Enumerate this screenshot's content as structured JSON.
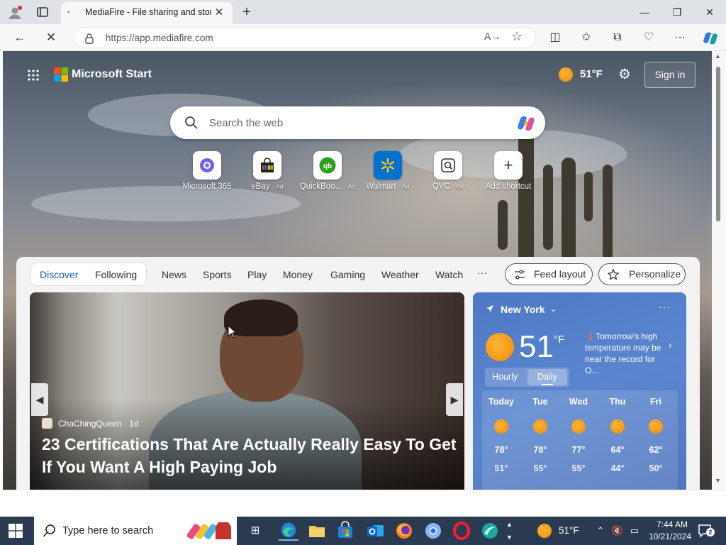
{
  "browser": {
    "tab_title": "MediaFire - File sharing and storage",
    "tab_close": "✕",
    "new_tab": "+",
    "url": "https://app.mediafire.com",
    "read_aloud": "A→",
    "window_buttons": {
      "minimize": "—",
      "restore": "❐",
      "close": "✕"
    }
  },
  "header": {
    "brand": "Microsoft Start",
    "temp": "51°F",
    "sign_in": "Sign in"
  },
  "search": {
    "placeholder": "Search the web"
  },
  "shortcuts": [
    {
      "name": "Microsoft 365",
      "ad": ""
    },
    {
      "name": "eBay",
      "ad": "· Ad"
    },
    {
      "name": "QuickBoo...",
      "ad": "· Ad"
    },
    {
      "name": "Walmart",
      "ad": "· Ad"
    },
    {
      "name": "QVC",
      "ad": "· Ad"
    },
    {
      "name": "Add shortcut",
      "ad": ""
    }
  ],
  "feed_nav": {
    "discover": "Discover",
    "following": "Following",
    "tabs": [
      "News",
      "Sports",
      "Play",
      "Money",
      "Gaming",
      "Weather",
      "Watch"
    ],
    "more": "···",
    "feed_layout": "Feed layout",
    "personalize": "Personalize"
  },
  "story": {
    "source": "ChaChingQueen",
    "age": "· 1d",
    "headline": "23 Certifications That Are Actually Really Easy To Get If You Want A High Paying Job"
  },
  "weather": {
    "city": "New York",
    "temp": "51",
    "unit": "°F",
    "alert": "Tomorrow's high temperature may be near the record for O...",
    "toggle_hourly": "Hourly",
    "toggle_daily": "Daily",
    "days": [
      {
        "name": "Today",
        "hi": "78°",
        "lo": "51°"
      },
      {
        "name": "Tue",
        "hi": "78°",
        "lo": "55°"
      },
      {
        "name": "Wed",
        "hi": "77°",
        "lo": "55°"
      },
      {
        "name": "Thu",
        "hi": "64°",
        "lo": "44°"
      },
      {
        "name": "Fri",
        "hi": "62°",
        "lo": "50°"
      }
    ]
  },
  "taskbar": {
    "search_placeholder": "Type here to search",
    "temp": "51°F",
    "time": "7:44 AM",
    "date": "10/21/2024",
    "notification_count": "2"
  },
  "colors": {
    "accent": "#1464c8",
    "taskbar": "#2a3a50",
    "weather_card": "#5b86cf"
  }
}
